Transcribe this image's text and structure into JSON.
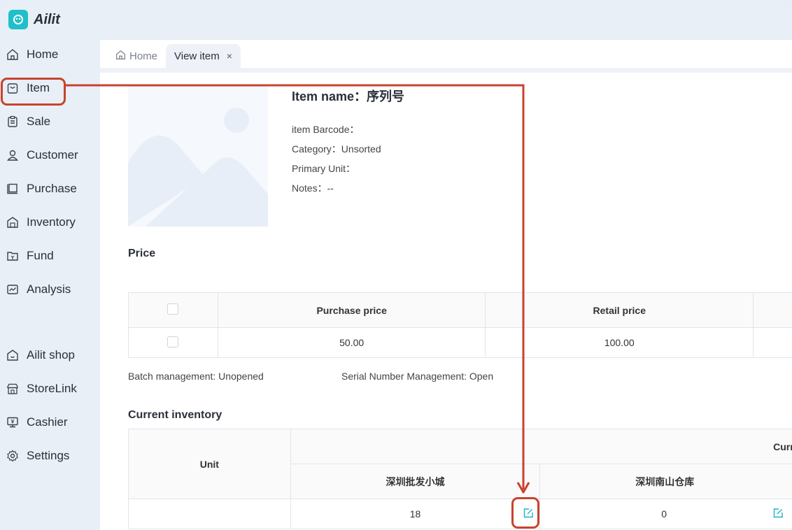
{
  "app": {
    "name": "Ailit"
  },
  "sidebar": {
    "items": [
      {
        "label": "Home",
        "icon": "home-icon"
      },
      {
        "label": "Item",
        "icon": "bag-icon"
      },
      {
        "label": "Sale",
        "icon": "clipboard-icon"
      },
      {
        "label": "Customer",
        "icon": "user-icon"
      },
      {
        "label": "Purchase",
        "icon": "cart-icon"
      },
      {
        "label": "Inventory",
        "icon": "warehouse-icon"
      },
      {
        "label": "Fund",
        "icon": "wallet-icon"
      },
      {
        "label": "Analysis",
        "icon": "chart-icon"
      },
      {
        "label": "Ailit shop",
        "icon": "shop-icon"
      },
      {
        "label": "StoreLink",
        "icon": "store-icon"
      },
      {
        "label": "Cashier",
        "icon": "cashier-icon"
      },
      {
        "label": "Settings",
        "icon": "gear-icon"
      }
    ]
  },
  "tabs": [
    {
      "label": "Home"
    },
    {
      "label": "View item",
      "close": "×"
    }
  ],
  "item": {
    "title": "Item name：序列号",
    "barcode": "item Barcode：",
    "category": "Category：Unsorted",
    "unit": "Primary Unit：",
    "notes": "Notes：--"
  },
  "price": {
    "section": "Price",
    "headers": [
      "Purchase price",
      "Retail price"
    ],
    "values": [
      "50.00",
      "100.00"
    ]
  },
  "management": {
    "batch": "Batch management:  Unopened",
    "serial": "Serial Number Management:   Open"
  },
  "inventory": {
    "section": "Current inventory",
    "unit_header": "Unit",
    "group_header": "Current in",
    "warehouses": [
      "深圳批发小城",
      "深圳南山仓库"
    ],
    "quantities": [
      "18",
      "0"
    ]
  },
  "colors": {
    "accent": "#1fc0c9",
    "annotation": "#c8432e"
  }
}
